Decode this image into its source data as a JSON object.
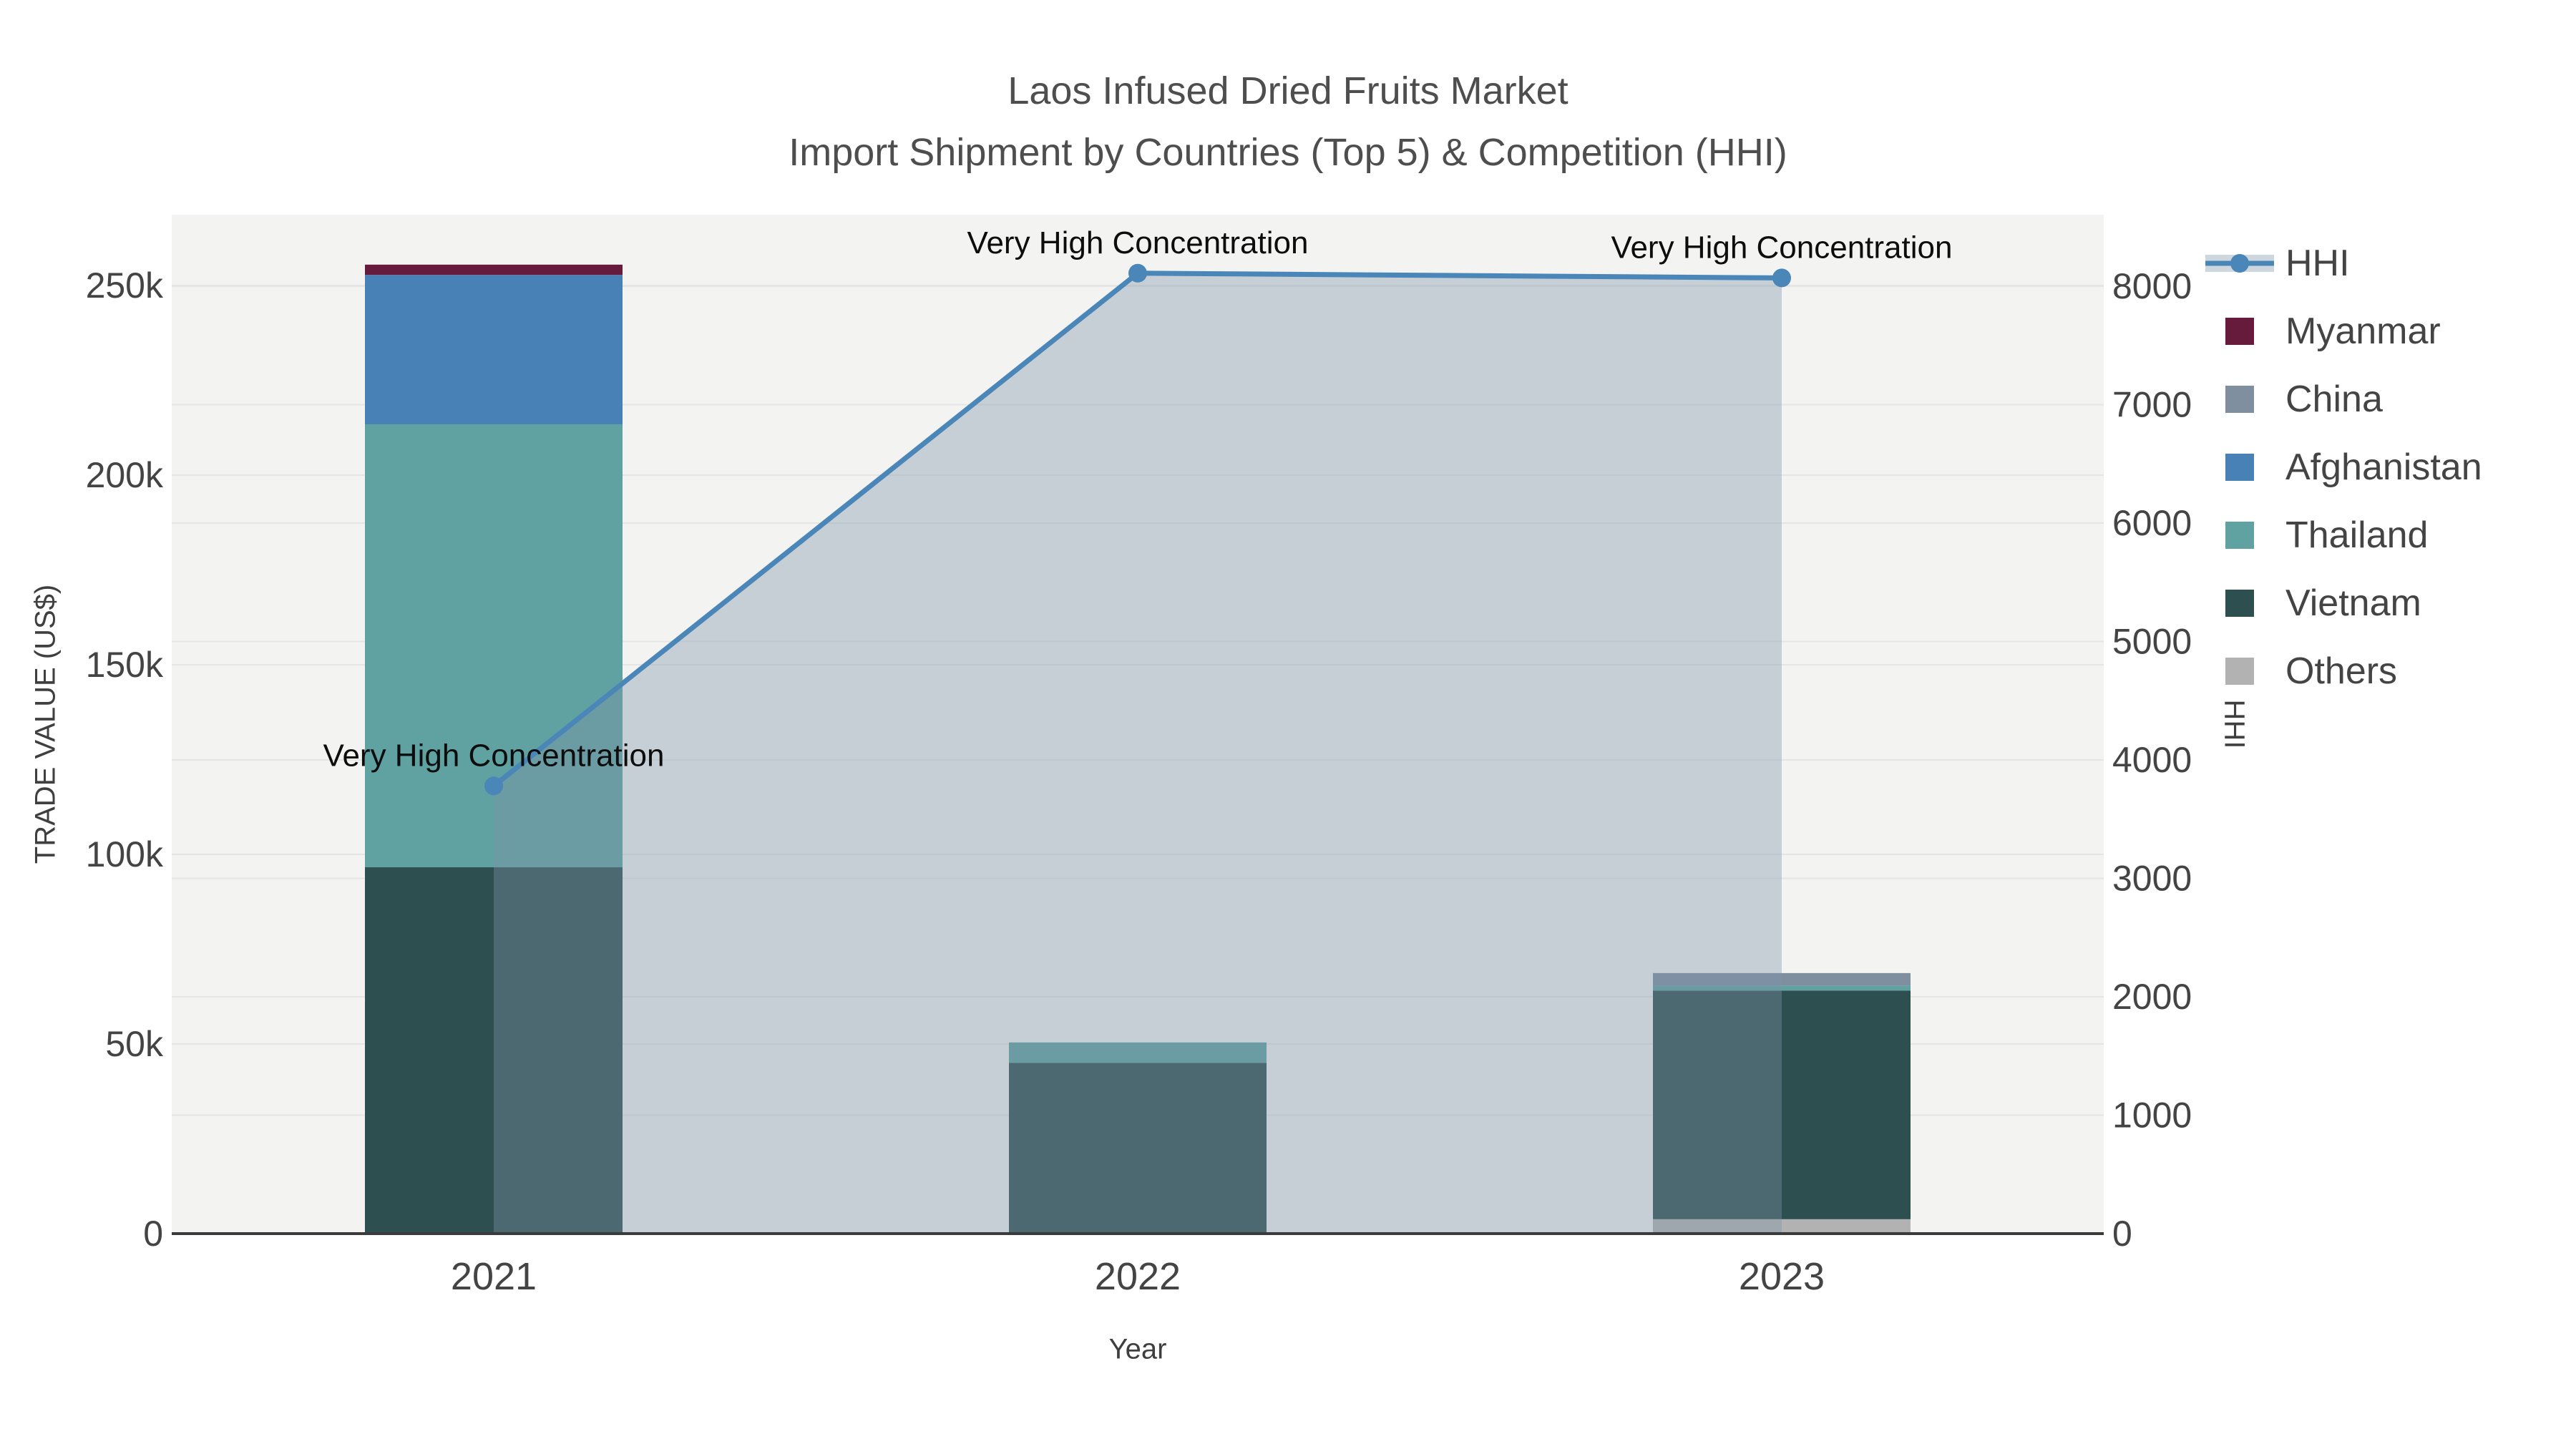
{
  "title": {
    "line1": "Laos Infused Dried Fruits Market",
    "line2": "Import Shipment by Countries (Top 5) & Competition (HHI)"
  },
  "axes": {
    "x": {
      "title": "Year",
      "tick_labels": [
        "2021",
        "2022",
        "2023"
      ]
    },
    "y_left": {
      "title": "TRADE VALUE (US$)",
      "tick_labels": [
        "0",
        "50k",
        "100k",
        "150k",
        "200k",
        "250k"
      ],
      "tick_values": [
        0,
        50000,
        100000,
        150000,
        200000,
        250000
      ],
      "range": [
        0,
        268700
      ]
    },
    "y_right": {
      "title": "HHI",
      "tick_labels": [
        "0",
        "1000",
        "2000",
        "3000",
        "4000",
        "5000",
        "6000",
        "7000",
        "8000"
      ],
      "tick_values": [
        0,
        1000,
        2000,
        3000,
        4000,
        5000,
        6000,
        7000,
        8000
      ],
      "range": [
        0,
        8604
      ]
    }
  },
  "legend": {
    "items": [
      {
        "label": "HHI",
        "type": "line",
        "color": "#4a86b8"
      },
      {
        "label": "Myanmar",
        "type": "square",
        "color": "#671b3c"
      },
      {
        "label": "China",
        "type": "square",
        "color": "#7f8fa0"
      },
      {
        "label": "Afghanistan",
        "type": "square",
        "color": "#4781b5"
      },
      {
        "label": "Thailand",
        "type": "square",
        "color": "#60a1a1"
      },
      {
        "label": "Vietnam",
        "type": "square",
        "color": "#2e4f4f"
      },
      {
        "label": "Others",
        "type": "square",
        "color": "#b2b2b2"
      }
    ]
  },
  "annotations": [
    {
      "text": "Very High Concentration",
      "category": "2021"
    },
    {
      "text": "Very High Concentration",
      "category": "2022"
    },
    {
      "text": "Very High Concentration",
      "category": "2023"
    }
  ],
  "chart_data": {
    "type": "bar+line",
    "categories": [
      "2021",
      "2022",
      "2023"
    ],
    "bar_stack_order_note": "stacked bottom-to-top in listed order",
    "series": [
      {
        "name": "Others",
        "type": "bar",
        "color": "#b2b2b2",
        "values": [
          0,
          0,
          3800
        ]
      },
      {
        "name": "Vietnam",
        "type": "bar",
        "color": "#2e4f4f",
        "values": [
          96600,
          45000,
          60300
        ]
      },
      {
        "name": "Thailand",
        "type": "bar",
        "color": "#60a1a1",
        "values": [
          116800,
          5400,
          1300
        ]
      },
      {
        "name": "Afghanistan",
        "type": "bar",
        "color": "#4781b5",
        "values": [
          39400,
          0,
          0
        ]
      },
      {
        "name": "China",
        "type": "bar",
        "color": "#7f8fa0",
        "values": [
          0,
          0,
          3300
        ]
      },
      {
        "name": "Myanmar",
        "type": "bar",
        "color": "#671b3c",
        "values": [
          2700,
          0,
          0
        ]
      }
    ],
    "line_series": {
      "name": "HHI",
      "type": "line+area",
      "color": "#4a86b8",
      "area_fill": "rgba(126,146,168,0.38)",
      "values": [
        3780,
        8110,
        8070
      ],
      "axis": "y_right"
    },
    "bar_totals": [
      255500,
      50400,
      68700
    ],
    "title": "Laos Infused Dried Fruits Market — Import Shipment by Countries (Top 5) & Competition (HHI)",
    "xlabel": "Year",
    "ylabel_left": "TRADE VALUE (US$)",
    "ylabel_right": "HHI",
    "grid": true,
    "legend_position": "right",
    "plot_background": "#f3f3f2",
    "grid_color": "#e5e5e5",
    "zero_line_color": "#3b3b3b",
    "tick_color": "#444444"
  }
}
